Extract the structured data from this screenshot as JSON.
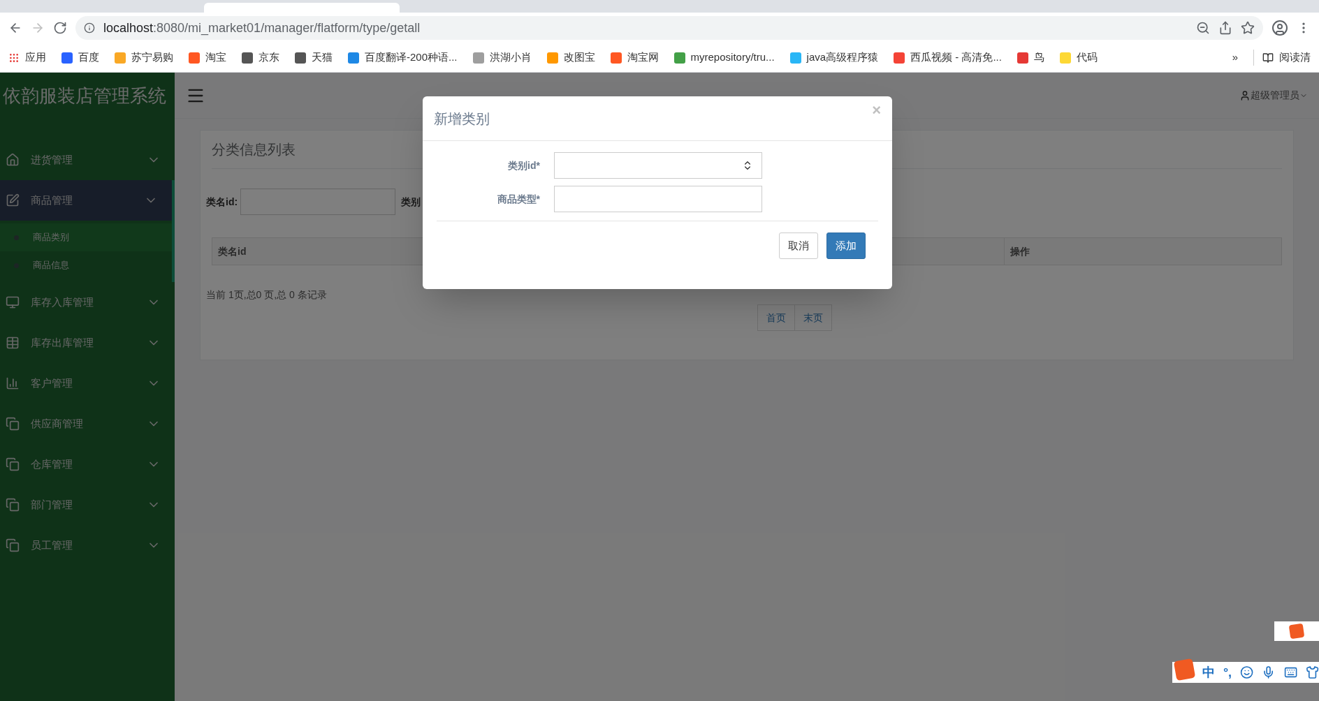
{
  "browser": {
    "url_host": "localhost",
    "url_rest": ":8080/mi_market01/manager/flatform/type/getall",
    "apps": "应用",
    "bookmarks": [
      {
        "label": "百度",
        "color": "#2962ff"
      },
      {
        "label": "苏宁易购",
        "color": "#f9a825"
      },
      {
        "label": "淘宝",
        "color": "#ff5722"
      },
      {
        "label": "京东",
        "color": "#555555"
      },
      {
        "label": "天猫",
        "color": "#555555"
      },
      {
        "label": "百度翻译-200种语...",
        "color": "#1e88e5"
      },
      {
        "label": "洪湖小肖",
        "color": "#9e9e9e"
      },
      {
        "label": "改图宝",
        "color": "#ff9800"
      },
      {
        "label": "淘宝网",
        "color": "#ff5722"
      },
      {
        "label": "myrepository/tru...",
        "color": "#43a047"
      },
      {
        "label": "java高级程序猿",
        "color": "#29b6f6"
      },
      {
        "label": "西瓜视频 - 高清免...",
        "color": "#f44336"
      },
      {
        "label": "鸟",
        "color": "#e53935"
      },
      {
        "label": "代码",
        "color": "#fdd835"
      }
    ],
    "more": "»",
    "reading_list": "阅读清"
  },
  "sidebar": {
    "title": "依韵服装店管理系统",
    "menu": [
      {
        "label": "进货管理",
        "kind": "home",
        "expanded": false
      },
      {
        "label": "商品管理",
        "kind": "edit",
        "expanded": true,
        "children": [
          {
            "label": "商品类别",
            "selected": true
          },
          {
            "label": "商品信息",
            "selected": false
          }
        ]
      },
      {
        "label": "库存入库管理",
        "kind": "monitor",
        "expanded": false
      },
      {
        "label": "库存出库管理",
        "kind": "table",
        "expanded": false
      },
      {
        "label": "客户管理",
        "kind": "chart",
        "expanded": false
      },
      {
        "label": "供应商管理",
        "kind": "copy",
        "expanded": false
      },
      {
        "label": "仓库管理",
        "kind": "copy",
        "expanded": false
      },
      {
        "label": "部门管理",
        "kind": "copy",
        "expanded": false
      },
      {
        "label": "员工管理",
        "kind": "copy",
        "expanded": false
      }
    ]
  },
  "header": {
    "user": "超级管理员"
  },
  "panel": {
    "title": "分类信息列表",
    "search": [
      {
        "label": "类名id:"
      },
      {
        "label": "类别"
      }
    ],
    "columns": [
      "类名id",
      "操作"
    ],
    "page_info": "当前 1页,总0 页,总 0 条记录",
    "pages": [
      "首页",
      "末页"
    ]
  },
  "modal": {
    "title": "新增类别",
    "close": "×",
    "fields": [
      {
        "label": "类别id*",
        "kind": "number"
      },
      {
        "label": "商品类型*",
        "kind": "text"
      }
    ],
    "buttons": [
      {
        "label": "取消",
        "kind": "default"
      },
      {
        "label": "添加",
        "kind": "primary"
      }
    ]
  },
  "ime": {
    "status": [
      "中",
      "°,"
    ]
  }
}
